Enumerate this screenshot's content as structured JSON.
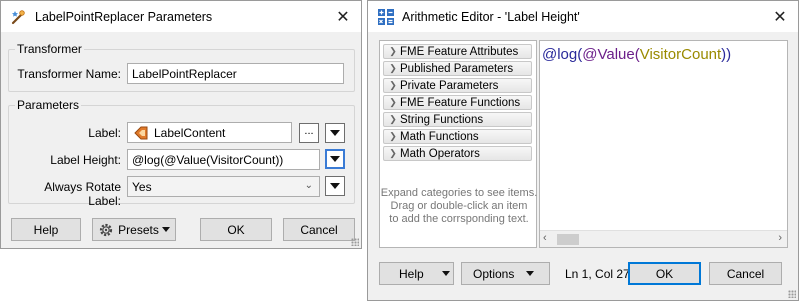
{
  "left_dialog": {
    "title": "LabelPointReplacer Parameters",
    "transformer_group": {
      "legend": "Transformer",
      "name_label": "Transformer Name:",
      "name_value": "LabelPointReplacer"
    },
    "parameters_group": {
      "legend": "Parameters",
      "label_label": "Label:",
      "label_value": "LabelContent",
      "ellipsis": "...",
      "height_label": "Label Height:",
      "height_value": "@log(@Value(VisitorCount))",
      "rotate_label": "Always Rotate Label:",
      "rotate_value": "Yes"
    },
    "buttons": {
      "help": "Help",
      "presets": "Presets",
      "ok": "OK",
      "cancel": "Cancel"
    }
  },
  "right_dialog": {
    "title": "Arithmetic Editor - 'Label Height'",
    "categories": [
      "FME Feature Attributes",
      "Published Parameters",
      "Private Parameters",
      "FME Feature Functions",
      "String Functions",
      "Math Functions",
      "Math Operators"
    ],
    "help_text_lines": [
      "Expand categories to see items.",
      "Drag or double-click an item",
      "to add the corrsponding text."
    ],
    "expression_parts": {
      "p1": "@log(",
      "p2": "@Value(",
      "p3": "VisitorCount",
      "p4": "))"
    },
    "buttons": {
      "help": "Help",
      "options": "Options",
      "ok": "OK",
      "cancel": "Cancel"
    },
    "status": "Ln 1, Col 27"
  },
  "colors": {
    "func": "#2a2a9a",
    "value": "#6b1f8a",
    "attr": "#9a8a00",
    "accent": "#0078d7"
  }
}
